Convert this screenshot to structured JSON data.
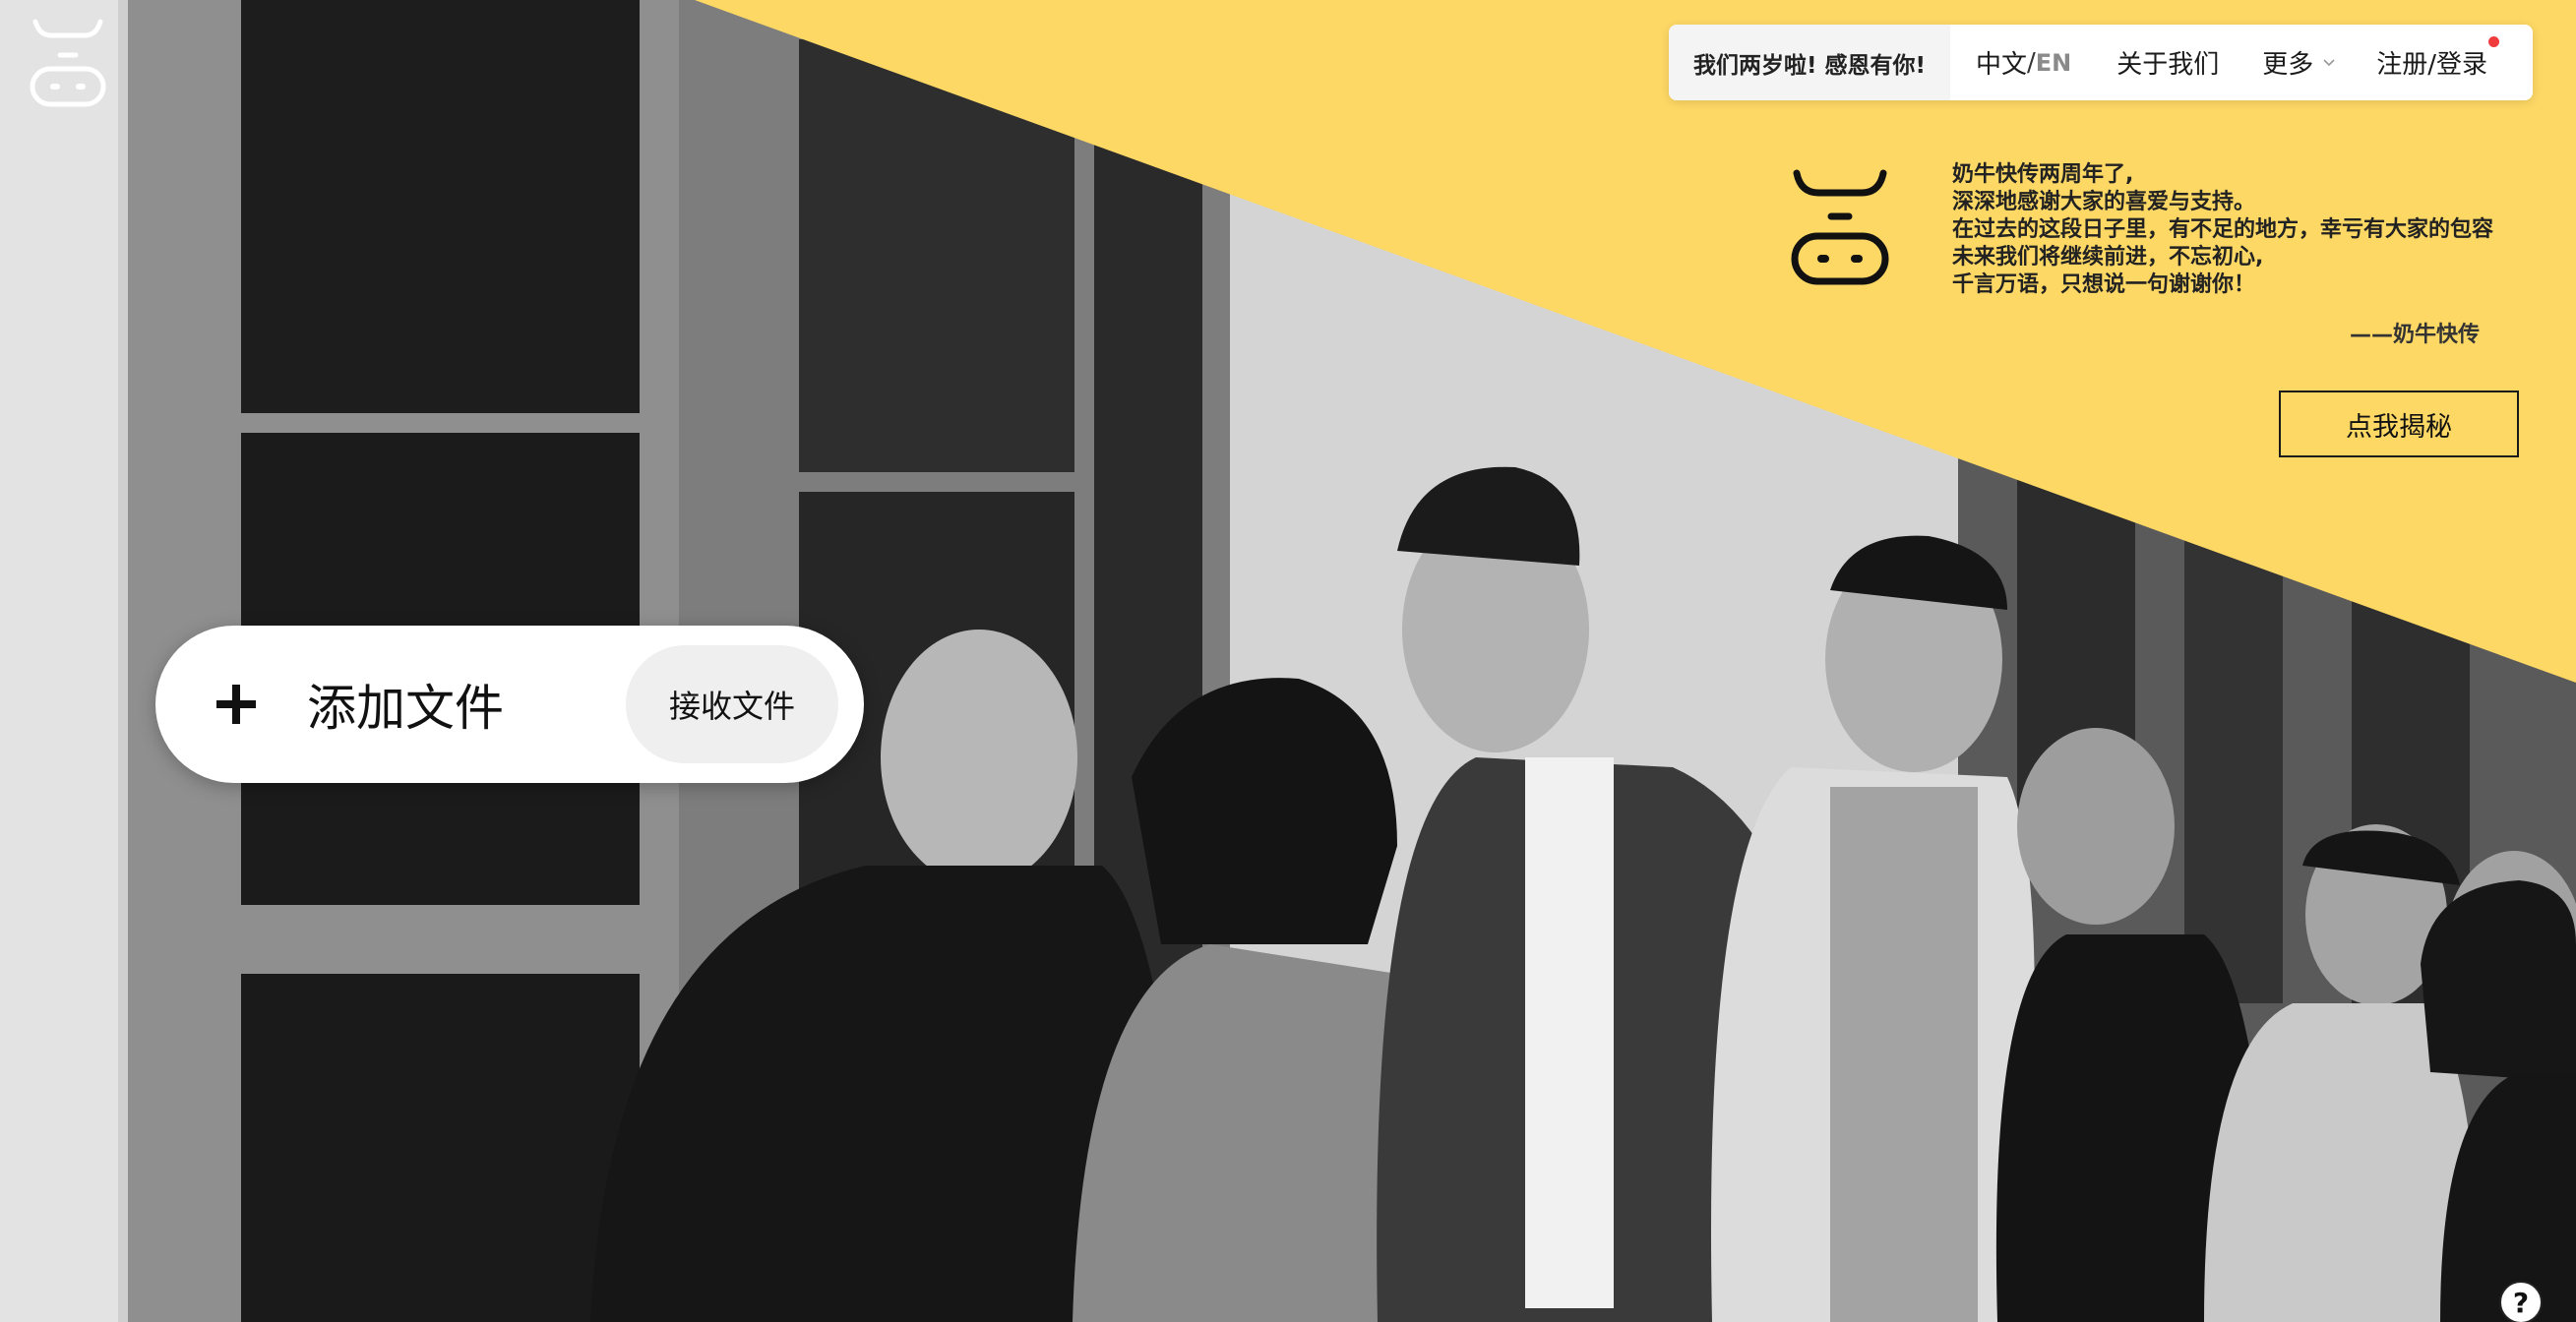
{
  "nav": {
    "promo": "我们两岁啦! 感恩有你!",
    "lang_zh": "中文",
    "lang_sep": "/",
    "lang_en": "EN",
    "about": "关于我们",
    "more": "更多",
    "login": "注册/登录"
  },
  "anniversary": {
    "lines": [
      "奶牛快传两周年了,",
      "深深地感谢大家的喜爱与支持。",
      "在过去的这段日子里，有不足的地方，幸亏有大家的包容",
      "未来我们将继续前进，不忘初心,",
      "千言万语，只想说一句谢谢你！"
    ],
    "signature": "——奶牛快传",
    "button": "点我揭秘"
  },
  "upload": {
    "add_label": "添加文件",
    "receive_label": "接收文件"
  },
  "help": {
    "label": "?"
  },
  "colors": {
    "accent_yellow": "#fdd865",
    "notification_dot": "#f03c3c"
  },
  "icons": {
    "logo": "cow-logo-icon",
    "plus": "plus-icon",
    "chevron": "chevron-down-icon",
    "help": "help-icon"
  }
}
